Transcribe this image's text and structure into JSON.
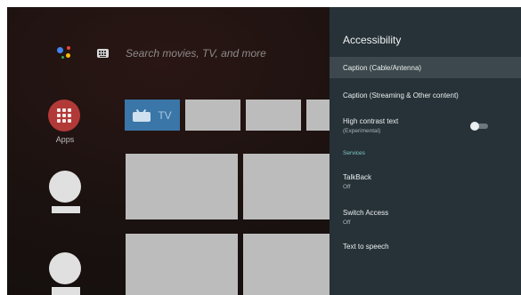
{
  "search": {
    "placeholder_text": "Search movies, TV, and more"
  },
  "apps": {
    "label": "Apps"
  },
  "tv_tile": {
    "label": "TV"
  },
  "panel": {
    "title": "Accessibility",
    "items": [
      {
        "label": "Caption (Cable/Antenna)"
      },
      {
        "label": "Caption (Streaming & Other content)"
      },
      {
        "label": "High contrast text",
        "sub": "(Experimental)",
        "toggle": "off"
      },
      {
        "label": "TalkBack",
        "sub": "Off"
      },
      {
        "label": "Switch Access",
        "sub": "Off"
      },
      {
        "label": "Text to speech"
      }
    ],
    "section_label": "Services"
  },
  "colors": {
    "panel_bg": "#263238",
    "selected_row": "#3c484d",
    "section_accent": "#80cbc4",
    "apps_red": "#b13a38",
    "tv_tile_blue": "#3a76a8"
  },
  "icons": [
    "google-assistant-icon",
    "keyboard-icon",
    "apps-grid-icon",
    "tv-icon",
    "toggle-switch"
  ]
}
